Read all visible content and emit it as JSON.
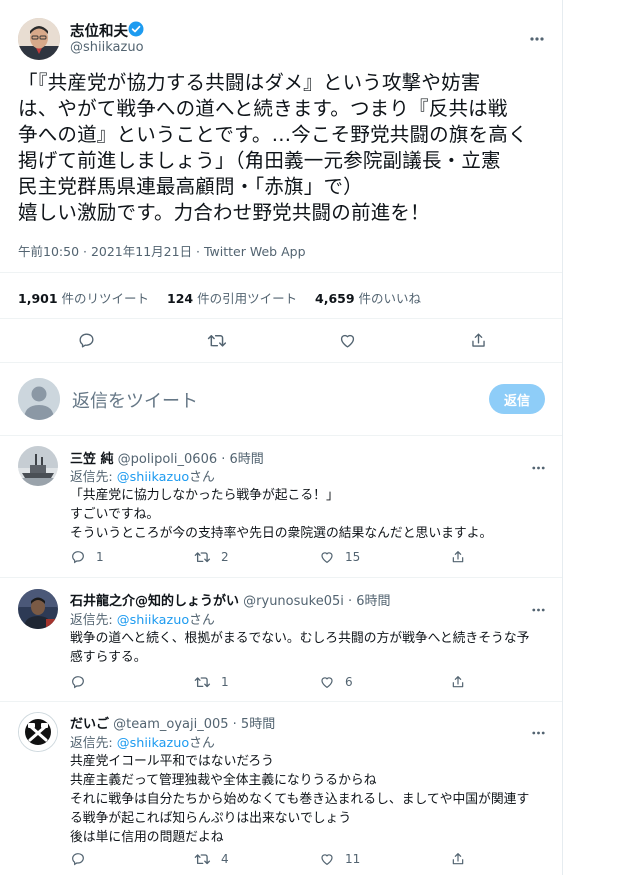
{
  "main_tweet": {
    "author_name": "志位和夫",
    "author_handle": "@shiikazuo",
    "text_lines": [
      "「『共産党が協力する共闘はダメ』という攻撃や妨害",
      "は、やがて戦争への道へと続きます。つまり『反共は戦",
      "争への道』ということです。…今こそ野党共闘の旗を高く",
      "掲げて前進しましょう」（角田義一元参院副議長・立憲",
      "民主党群馬県連最高顧問・「赤旗」で）",
      "嬉しい激励です。力合わせ野党共闘の前進を！"
    ],
    "meta": "午前10:50 · 2021年11月21日 · Twitter Web App",
    "retweets_count": "1,901",
    "retweets_label": "件のリツイート",
    "quotes_count": "124",
    "quotes_label": "件の引用ツイート",
    "likes_count": "4,659",
    "likes_label": "件のいいね"
  },
  "compose": {
    "placeholder": "返信をツイート",
    "button": "返信"
  },
  "replies": [
    {
      "name": "三笠 純",
      "handle": "@polipoli_0606",
      "time": "· 6時間",
      "reply_to_label": "返信先: ",
      "reply_to_handle": "@shiikazuo",
      "reply_to_suffix": "さん",
      "lines": [
        "「共産党に協力しなかったら戦争が起こる！」",
        "すごいですね。",
        "そういうところが今の支持率や先日の衆院選の結果なんだと思いますよ。"
      ],
      "replies": "1",
      "retweets": "2",
      "likes": "15"
    },
    {
      "name": "石井龍之介@知的しょうがい",
      "handle": "@ryunosuke05i",
      "time": "· 6時間",
      "reply_to_label": "返信先: ",
      "reply_to_handle": "@shiikazuo",
      "reply_to_suffix": "さん",
      "lines": [
        "戦争の道へと続く、根拠がまるでない。むしろ共闘の方が戦争へと続きそうな予",
        "感すらする。"
      ],
      "replies": "",
      "retweets": "1",
      "likes": "6"
    },
    {
      "name": "だいご",
      "handle": "@team_oyaji_005",
      "time": "· 5時間",
      "reply_to_label": "返信先: ",
      "reply_to_handle": "@shiikazuo",
      "reply_to_suffix": "さん",
      "lines": [
        "共産党イコール平和ではないだろう",
        "共産主義だって管理独裁や全体主義になりうるからね",
        "それに戦争は自分たちから始めなくても巻き込まれるし、ましてや中国が関連す",
        "る戦争が起これば知らんぷりは出来ないでしょう",
        "後は単に信用の問題だよね"
      ],
      "replies": "",
      "retweets": "4",
      "likes": "11"
    }
  ],
  "colors": {
    "accent": "#1d9bf0",
    "muted": "#536471",
    "reply_button": "#8ecdf8"
  }
}
